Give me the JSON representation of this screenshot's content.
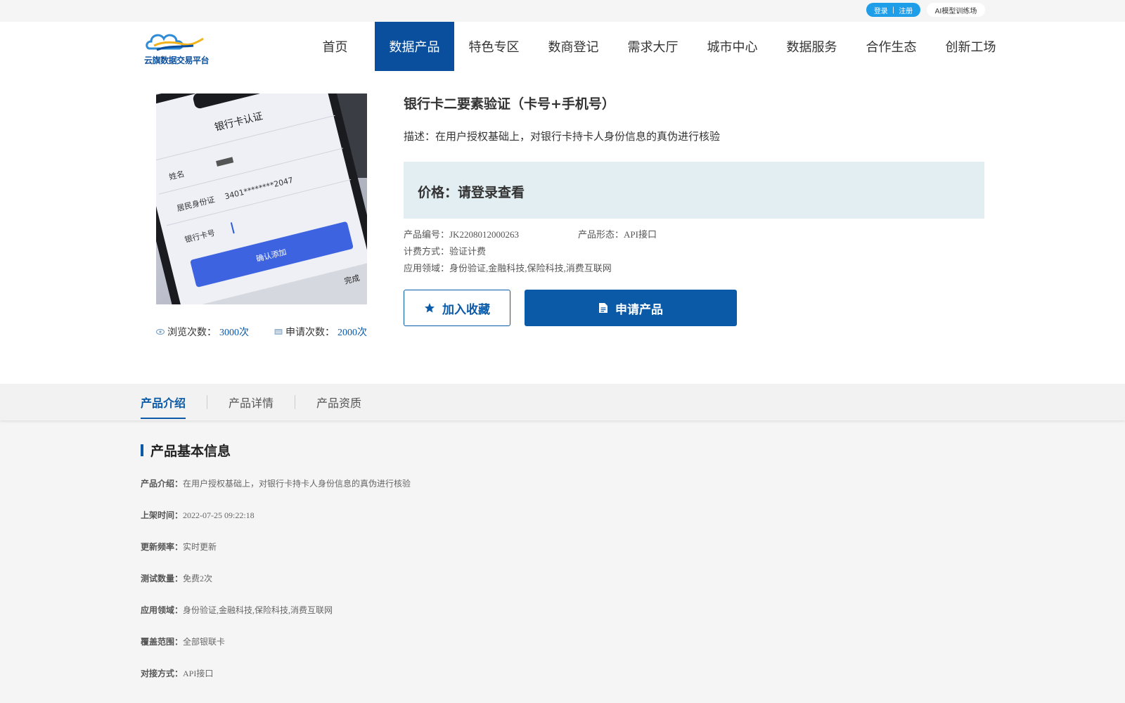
{
  "topbar": {
    "login": "登录",
    "sep": "|",
    "register": "注册",
    "ai_training": "AI模型训练场"
  },
  "header": {
    "logo_text": "云旗数据交易平台",
    "nav": [
      {
        "label": "首页"
      },
      {
        "label": "数据产品"
      },
      {
        "label": "特色专区"
      },
      {
        "label": "数商登记"
      },
      {
        "label": "需求大厅"
      },
      {
        "label": "城市中心"
      },
      {
        "label": "数据服务"
      },
      {
        "label": "合作生态"
      },
      {
        "label": "创新工场"
      }
    ],
    "active_index": 1
  },
  "product": {
    "title": "银行卡二要素验证（卡号+手机号）",
    "description": "描述：在用户授权基础上，对银行卡持卡人身份信息的真伪进行核验",
    "price": "价格：请登录查看",
    "code_label": "产品编号：JK2208012000263",
    "form_label": "产品形态：API接口",
    "billing_label": "计费方式：验证计费",
    "domain_label": "应用领域：身份验证,金融科技,保险科技,消费互联网",
    "favorite_button": "加入收藏",
    "apply_button": "申请产品",
    "views_label": "浏览次数：",
    "views_value": "3000次",
    "applies_label": "申请次数：",
    "applies_value": "2000次"
  },
  "tabs": [
    {
      "label": "产品介绍"
    },
    {
      "label": "产品详情"
    },
    {
      "label": "产品资质"
    }
  ],
  "basic_info": {
    "heading": "产品基本信息",
    "rows": [
      {
        "key": "产品介绍：",
        "value": "在用户授权基础上，对银行卡持卡人身份信息的真伪进行核验"
      },
      {
        "key": "上架时间：",
        "value": "2022-07-25 09:22:18"
      },
      {
        "key": "更新频率：",
        "value": "实时更新"
      },
      {
        "key": "测试数量：",
        "value": "免费2次"
      },
      {
        "key": "应用领域：",
        "value": "身份验证,金融科技,保险科技,消费互联网"
      },
      {
        "key": "覆盖范围：",
        "value": "全部银联卡"
      },
      {
        "key": "对接方式：",
        "value": "API接口"
      }
    ]
  },
  "phone_image": {
    "screen_title": "银行卡认证",
    "name_label": "姓名",
    "id_label": "居民身份证",
    "id_value": "3401********2047",
    "card_label": "银行卡号",
    "confirm": "确认添加",
    "done": "完成"
  },
  "colors": {
    "primary": "#0a5aa8",
    "nav_active": "#0a4f9e",
    "price_bg": "#e3eef3",
    "login_pill": "#1e9de8"
  }
}
